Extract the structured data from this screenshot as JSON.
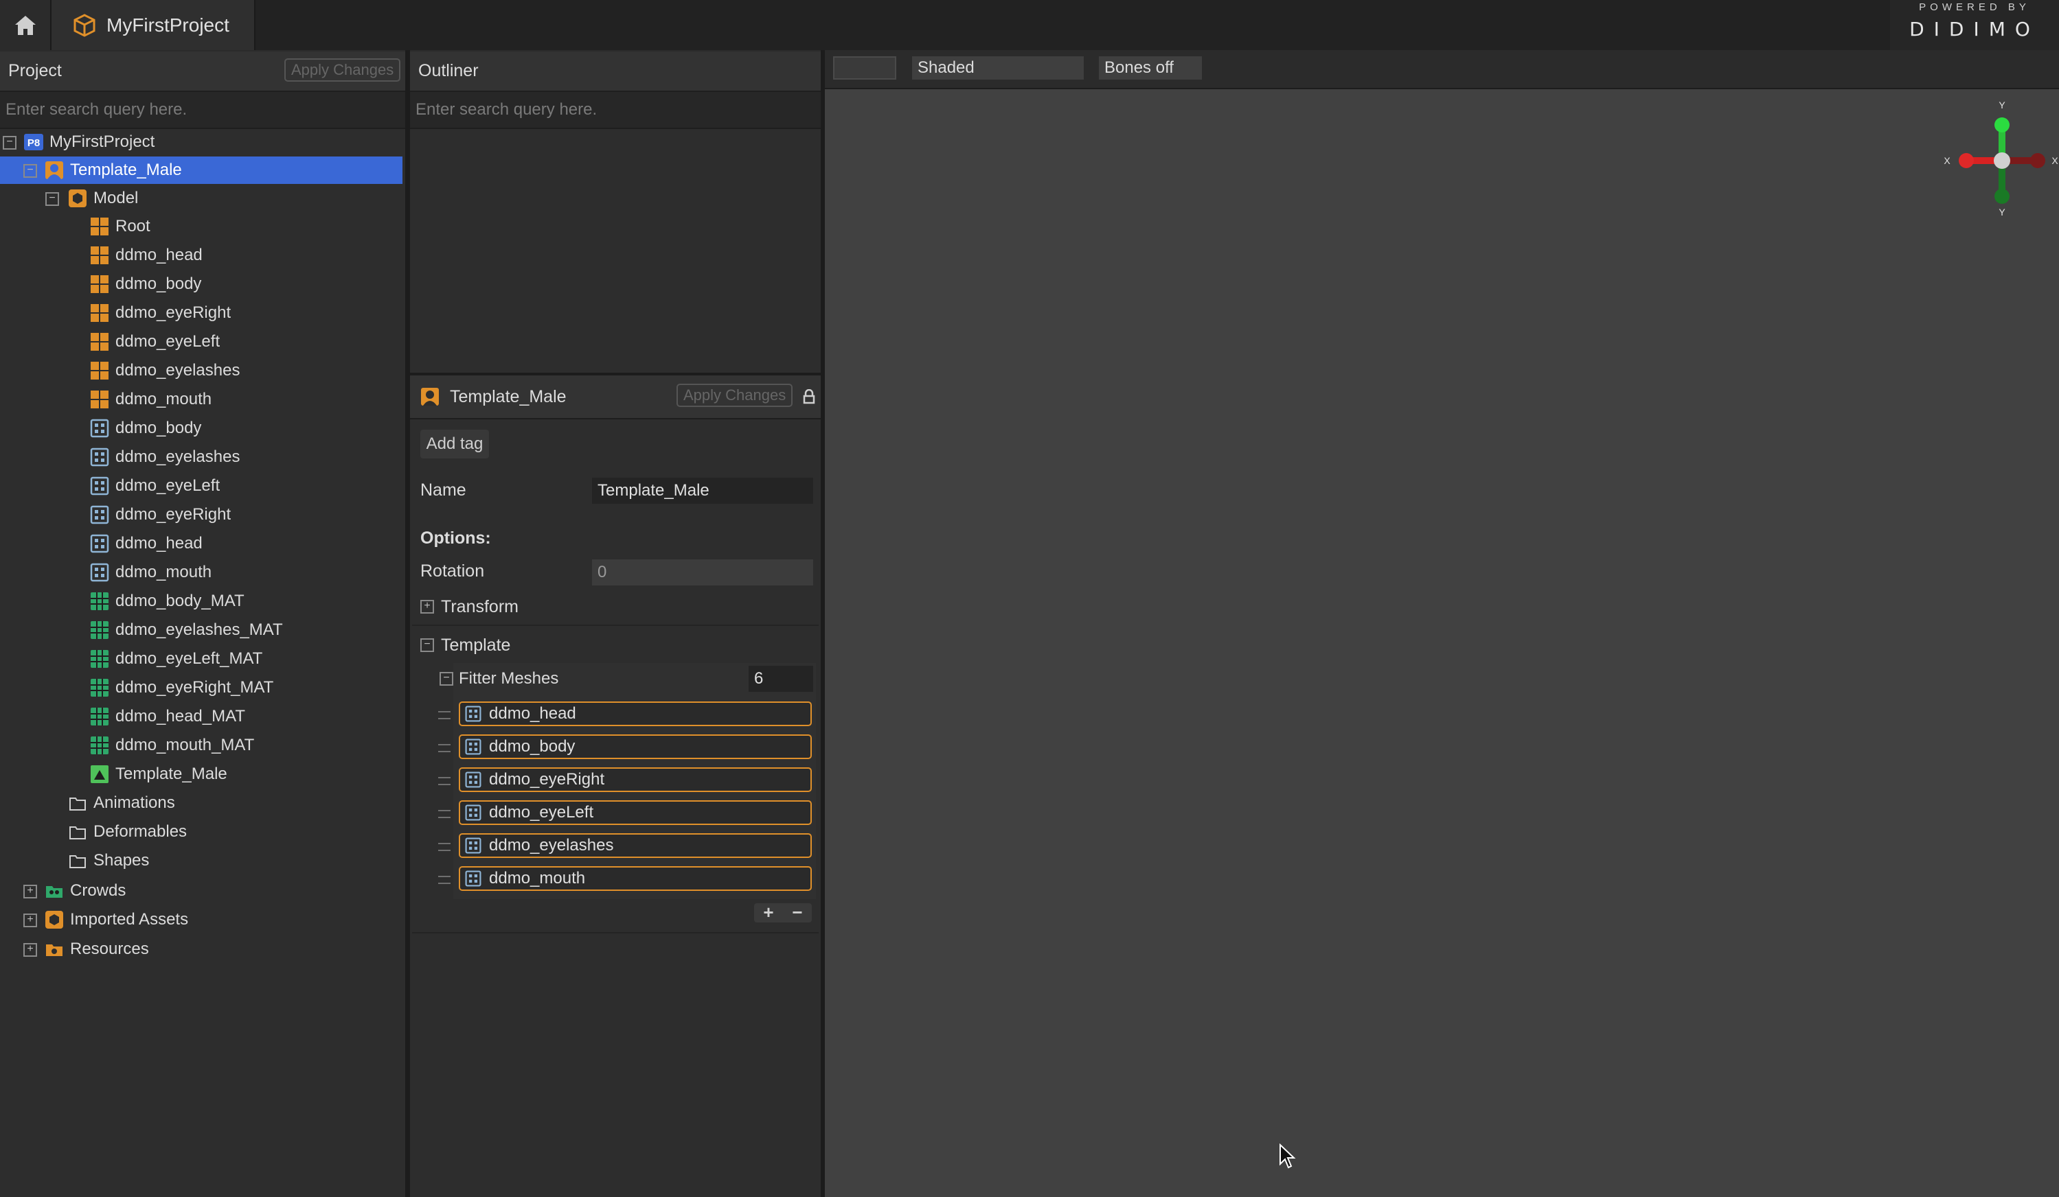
{
  "top_bar": {
    "project_tab": "MyFirstProject",
    "logo_powered_by": "POWERED BY",
    "logo_name": "DIDIMO"
  },
  "project_panel": {
    "title": "Project",
    "apply_label": "Apply Changes",
    "search_placeholder": "Enter search query here.",
    "tree": [
      {
        "label": "MyFirstProject",
        "icon": "project-badge-icon",
        "badge": "P8"
      },
      {
        "label": "Template_Male",
        "icon": "character-icon",
        "selected": true
      },
      {
        "label": "Model",
        "icon": "model-icon"
      },
      {
        "label": "Root",
        "icon": "joint-grid-icon"
      },
      {
        "label": "ddmo_head",
        "icon": "joint-grid-icon"
      },
      {
        "label": "ddmo_body",
        "icon": "joint-grid-icon"
      },
      {
        "label": "ddmo_eyeRight",
        "icon": "joint-grid-icon"
      },
      {
        "label": "ddmo_eyeLeft",
        "icon": "joint-grid-icon"
      },
      {
        "label": "ddmo_eyelashes",
        "icon": "joint-grid-icon"
      },
      {
        "label": "ddmo_mouth",
        "icon": "joint-grid-icon"
      },
      {
        "label": "ddmo_body",
        "icon": "mesh-icon"
      },
      {
        "label": "ddmo_eyelashes",
        "icon": "mesh-icon"
      },
      {
        "label": "ddmo_eyeLeft",
        "icon": "mesh-icon"
      },
      {
        "label": "ddmo_eyeRight",
        "icon": "mesh-icon"
      },
      {
        "label": "ddmo_head",
        "icon": "mesh-icon"
      },
      {
        "label": "ddmo_mouth",
        "icon": "mesh-icon"
      },
      {
        "label": "ddmo_body_MAT",
        "icon": "material-icon"
      },
      {
        "label": "ddmo_eyelashes_MAT",
        "icon": "material-icon"
      },
      {
        "label": "ddmo_eyeLeft_MAT",
        "icon": "material-icon"
      },
      {
        "label": "ddmo_eyeRight_MAT",
        "icon": "material-icon"
      },
      {
        "label": "ddmo_head_MAT",
        "icon": "material-icon"
      },
      {
        "label": "ddmo_mouth_MAT",
        "icon": "material-icon"
      },
      {
        "label": "Template_Male",
        "icon": "template-icon"
      },
      {
        "label": "Animations",
        "icon": "folder-icon"
      },
      {
        "label": "Deformables",
        "icon": "folder-icon"
      },
      {
        "label": "Shapes",
        "icon": "folder-icon"
      },
      {
        "label": "Crowds",
        "icon": "crowds-folder-icon"
      },
      {
        "label": "Imported Assets",
        "icon": "imported-assets-icon"
      },
      {
        "label": "Resources",
        "icon": "resources-icon"
      }
    ]
  },
  "outliner": {
    "title": "Outliner",
    "search_placeholder": "Enter search query here."
  },
  "properties": {
    "header_title": "Template_Male",
    "apply_label": "Apply Changes",
    "add_tag_label": "Add tag",
    "name_label": "Name",
    "name_value": "Template_Male",
    "options_label": "Options:",
    "rotation_label": "Rotation",
    "rotation_value": "0",
    "transform_label": "Transform",
    "template_label": "Template",
    "filter_meshes_label": "Fitter Meshes",
    "filter_meshes_count": "6",
    "meshes": [
      "ddmo_head",
      "ddmo_body",
      "ddmo_eyeRight",
      "ddmo_eyeLeft",
      "ddmo_eyelashes",
      "ddmo_mouth"
    ],
    "add_symbol": "+",
    "remove_symbol": "−"
  },
  "viewport_toolbar": {
    "shading_mode": "Shaded",
    "bones_mode": "Bones off"
  },
  "gizmo": {
    "y_top": "Y",
    "y_bottom": "Y",
    "x_left": "X",
    "x_right": "X"
  },
  "colors": {
    "selection": "#3a68d6",
    "accent_orange": "#e0902a",
    "material_green": "#2fa86a",
    "mesh_blue": "#8fb5d6"
  }
}
